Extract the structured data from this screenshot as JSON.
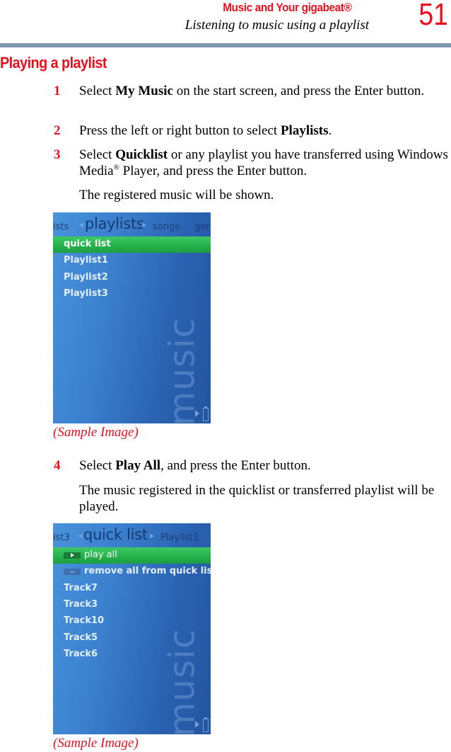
{
  "header": {
    "section": "Music and Your gigabeat®",
    "subsection": "Listening to music using a playlist",
    "page_number": "51",
    "accent_color": "#e8101e",
    "rule_color": "#7f98b0"
  },
  "title": "Playing a playlist",
  "steps": [
    {
      "num": "1",
      "pre": "Select ",
      "bold": "My Music",
      "post": " on the start screen, and press the Enter button."
    },
    {
      "num": "2",
      "pre": "Press the left or right button to select ",
      "bold": "Playlists",
      "post": "."
    },
    {
      "num": "3",
      "pre": "Select ",
      "bold": "Quicklist",
      "post_a": " or any playlist you have transferred using Windows Media",
      "sup": "®",
      "post_b": " Player, and press the Enter button."
    },
    {
      "num": "4",
      "pre": "Select ",
      "bold": "Play All",
      "post": ", and press the Enter button."
    }
  ],
  "notes": {
    "after_step3": "The registered music will be shown.",
    "after_step4": "The music registered in the quicklist or transferred playlist will be played."
  },
  "screen1": {
    "nav_prev": "ists",
    "nav_current": "playlists",
    "nav_next": "songs",
    "nav_far": "ger",
    "items": [
      "quick list",
      "Playlist1",
      "Playlist2",
      "Playlist3"
    ],
    "selected_index": 0,
    "watermark": "music"
  },
  "screen2": {
    "nav_prev": "ist3",
    "nav_current": "quick list",
    "nav_next": "Playlist1",
    "actions": [
      "play all",
      "remove all from quick list"
    ],
    "selected_index": 0,
    "tracks": [
      "Track7",
      "Track3",
      "Track10",
      "Track5",
      "Track6"
    ],
    "watermark": "music"
  },
  "captions": {
    "image1": "(Sample Image)",
    "image2": "(Sample Image)"
  }
}
